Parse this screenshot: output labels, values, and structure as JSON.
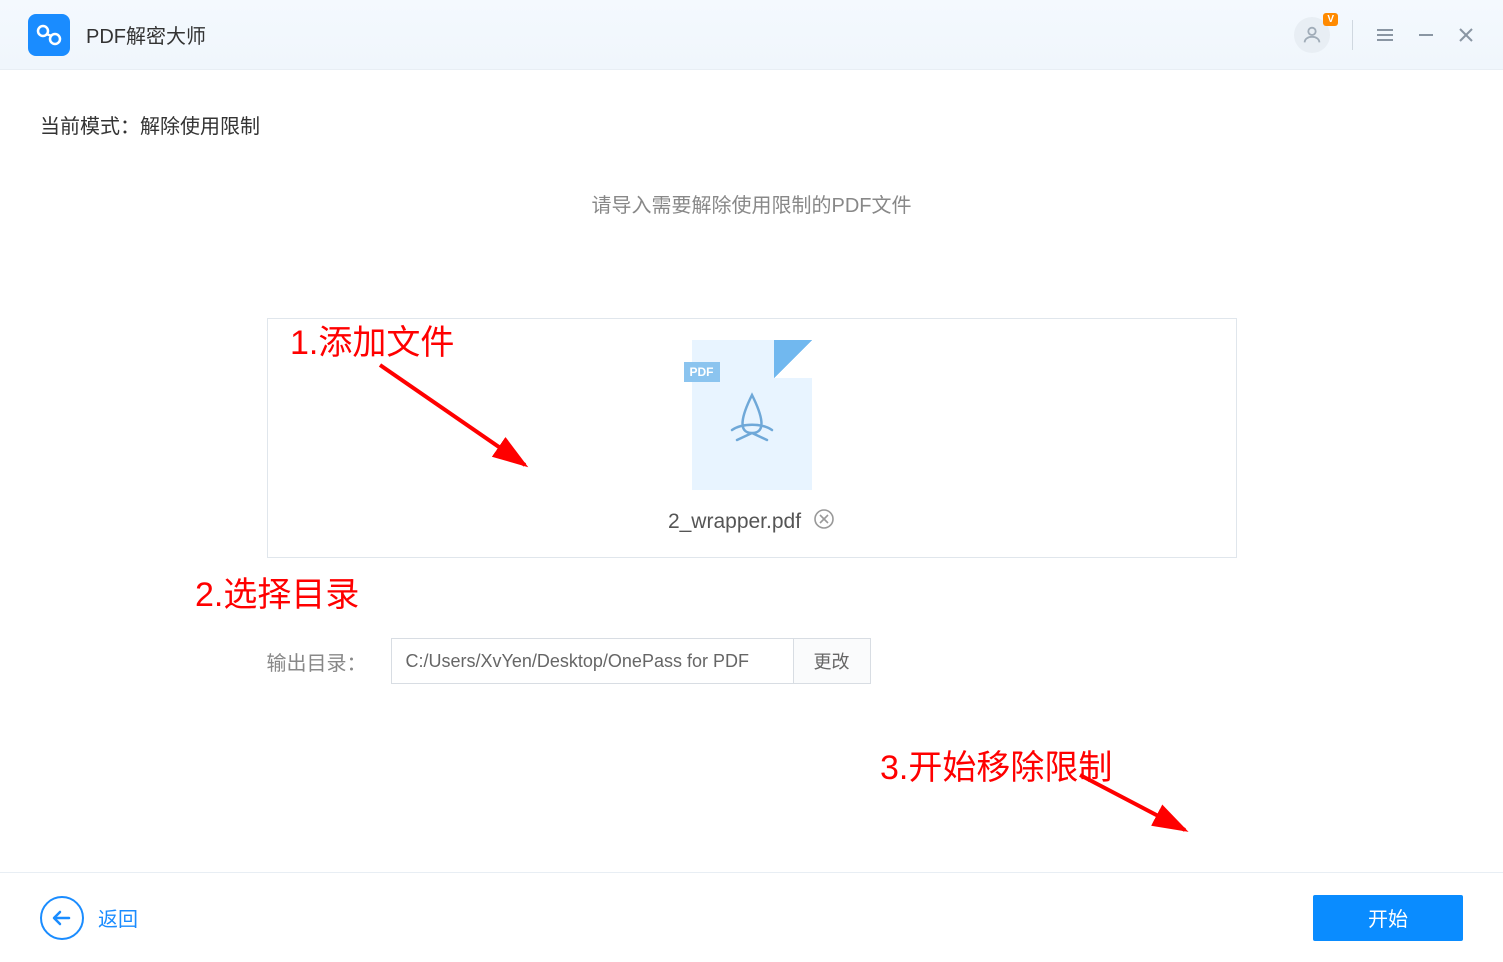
{
  "app": {
    "title": "PDF解密大师",
    "vip_badge": "V"
  },
  "mode": {
    "label_prefix": "当前模式：",
    "current": "解除使用限制"
  },
  "main": {
    "instruction": "请导入需要解除使用限制的PDF文件",
    "file": {
      "pdf_badge": "PDF",
      "name": "2_wrapper.pdf"
    }
  },
  "output": {
    "label": "输出目录：",
    "path": "C:/Users/XvYen/Desktop/OnePass for PDF",
    "change_button": "更改"
  },
  "footer": {
    "back_label": "返回",
    "start_label": "开始"
  },
  "annotations": {
    "a1": "1.添加文件",
    "a2": "2.选择目录",
    "a3": "3.开始移除限制"
  }
}
